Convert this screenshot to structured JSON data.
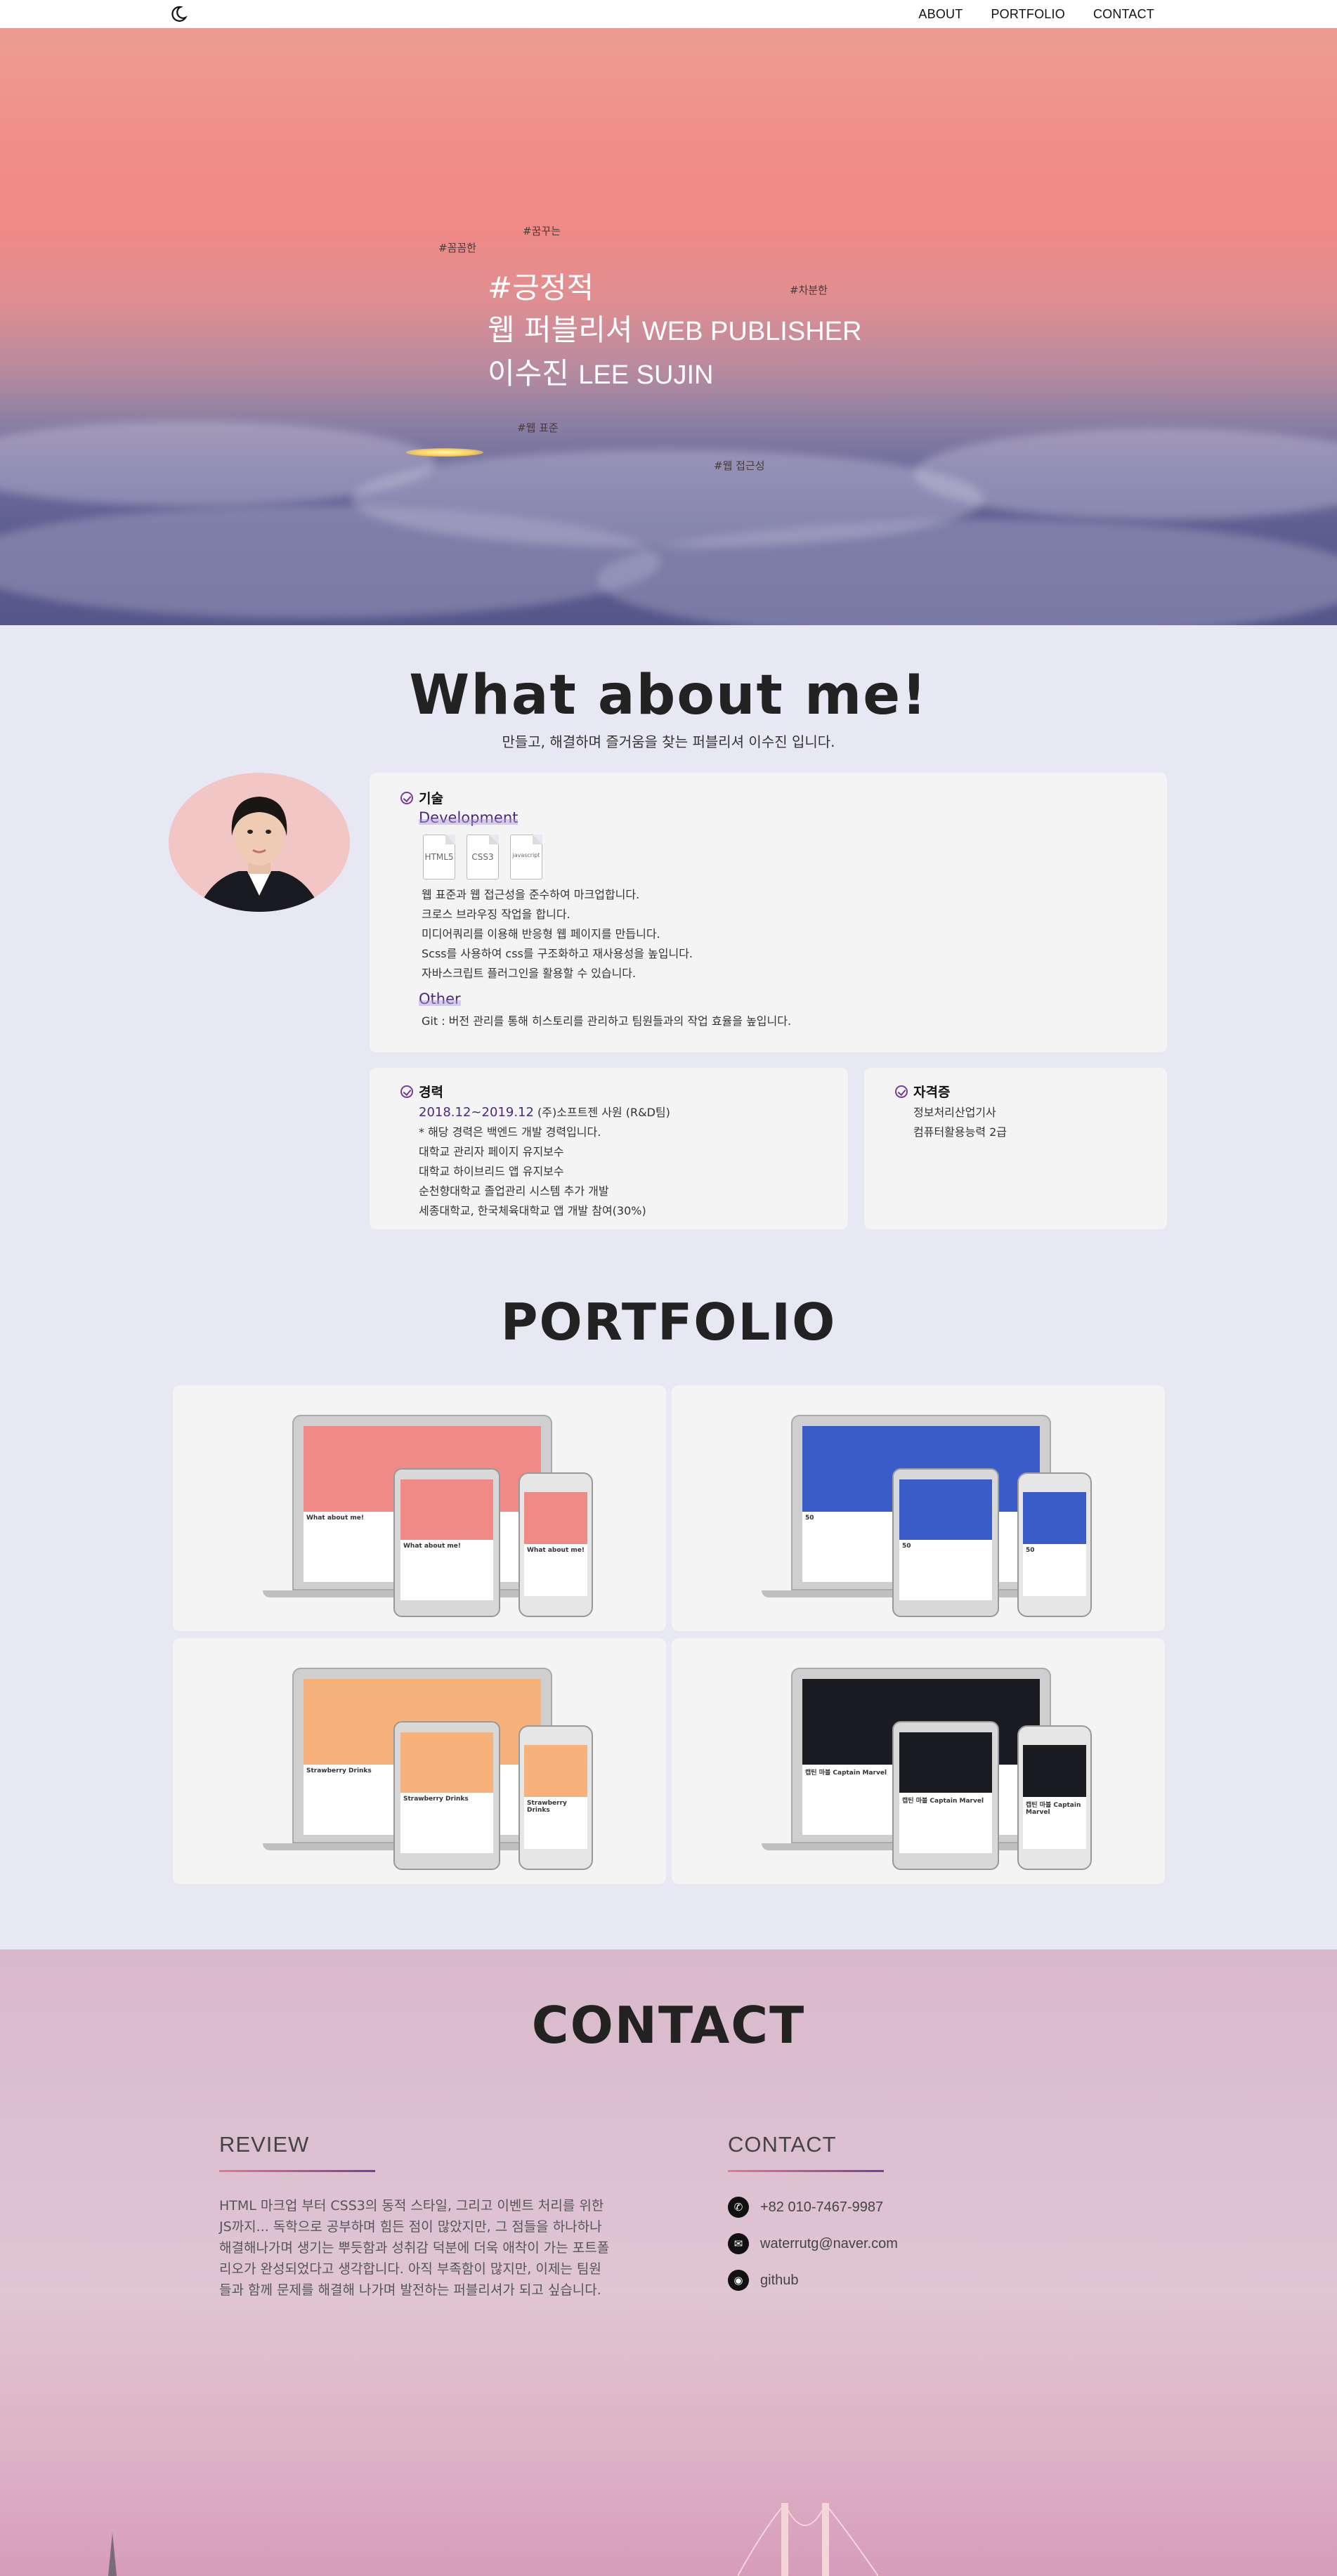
{
  "nav": {
    "about": "ABOUT",
    "portfolio": "PORTFOLIO",
    "contact": "CONTACT"
  },
  "hero": {
    "tags": [
      "#꼼꼼한",
      "#꿈꾸는",
      "#차분한",
      "#웹 표준",
      "#웹 접근성"
    ],
    "headline": "#긍정적",
    "role_ko": "웹 퍼블리셔",
    "role_en": "WEB PUBLISHER",
    "name_ko": "이수진",
    "name_en": "LEE SUJIN"
  },
  "about": {
    "title": "What about me!",
    "subtitle": "만들고, 해결하며 즐거움을 찾는 퍼블리셔 이수진 입니다.",
    "skills": {
      "heading": "기술",
      "dev_label": "Development",
      "files": [
        "HTML5",
        "CSS3",
        "javascript"
      ],
      "dev_lines": [
        "웹 표준과 웹 접근성을 준수하여 마크업합니다.",
        "크로스 브라우징 작업을 합니다.",
        "미디어쿼리를 이용해 반응형 웹 페이지를 만듭니다.",
        "Scss를 사용하여 css를 구조화하고 재사용성을 높입니다.",
        "자바스크립트 플러그인을 활용할 수 있습니다."
      ],
      "other_label": "Other",
      "other_line": "Git : 버전 관리를 통해 히스토리를 관리하고 팀원들과의 작업 효율을 높입니다."
    },
    "career": {
      "heading": "경력",
      "period": "2018.12~2019.12",
      "company": "(주)소프트젠 사원 (R&D팀)",
      "lines": [
        "* 해당 경력은 백엔드 개발 경력입니다.",
        "대학교 관리자 페이지 유지보수",
        "대학교 하이브리드 앱 유지보수",
        "순천향대학교 졸업관리 시스템 추가 개발",
        "세종대학교, 한국체육대학교 앱 개발 참여(30%)"
      ]
    },
    "license": {
      "heading": "자격증",
      "lines": [
        "정보처리산업기사",
        "컴퓨터활용능력 2급"
      ]
    }
  },
  "portfolio": {
    "title": "PORTFOLIO",
    "items": [
      {
        "name": "portfolio-site",
        "accent": "#ef8a86",
        "caption": "What about me!"
      },
      {
        "name": "government-site",
        "accent": "#3a5cc8",
        "caption": "50"
      },
      {
        "name": "strawberry-cafe",
        "accent": "#f6b27a",
        "caption": "Strawberry Drinks"
      },
      {
        "name": "movie-site",
        "accent": "#1b1b22",
        "caption": "캡틴 마블 Captain Marvel"
      }
    ]
  },
  "contact": {
    "title": "CONTACT",
    "review_heading": "REVIEW",
    "review_text": "HTML 마크업 부터 CSS3의 동적 스타일, 그리고 이벤트 처리를 위한 JS까지... 독학으로 공부하며 힘든 점이 많았지만, 그 점들을 하나하나 해결해나가며 생기는 뿌듯함과 성취감 덕분에 더욱 애착이 가는 포트폴리오가 완성되었다고 생각합니다. 아직 부족함이 많지만, 이제는 팀원들과 함께 문제를 해결해 나가며 발전하는 퍼블리셔가 되고 싶습니다.",
    "contact_heading": "CONTACT",
    "phone": "+82 010-7467-9987",
    "email": "waterrutg@naver.com",
    "github": "github"
  }
}
